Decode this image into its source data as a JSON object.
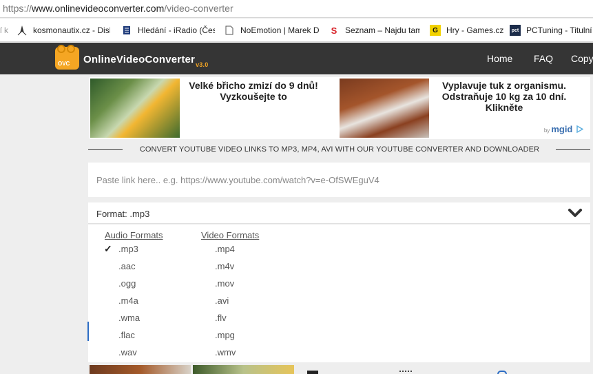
{
  "address_bar": {
    "protocol": "https://",
    "host": "www.onlinevideoconverter.com",
    "path": "/video-converter"
  },
  "bookmarks": [
    {
      "label": "ſ k",
      "icon": "partial-icon"
    },
    {
      "label": "kosmonautix.cz - Disk",
      "icon": "rocket-icon"
    },
    {
      "label": "Hledání - iRadio (Česk",
      "icon": "document-icon"
    },
    {
      "label": "NoEmotion | Marek D",
      "icon": "page-icon"
    },
    {
      "label": "Seznam – Najdu tam",
      "icon": "seznam-icon"
    },
    {
      "label": "Hry - Games.cz",
      "icon": "games-icon"
    },
    {
      "label": "PCTuning - Titulní",
      "icon": "pctuning-icon"
    }
  ],
  "site": {
    "logo_badge": "OVC",
    "logo_name": "OnlineVideoConverter",
    "logo_version": "v3.0",
    "nav": [
      "Home",
      "FAQ",
      "Copy"
    ]
  },
  "ads": {
    "ad1": {
      "line1": "Velké břicho zmizí do 9 dnů!",
      "line2": "Vyzkoušejte to"
    },
    "ad2": {
      "line1": "Vyplavuje tuk z organismu.",
      "line2": "Odstraňuje 10 kg za 10 dní.",
      "line3": "Klikněte"
    },
    "sponsor_by": "by",
    "sponsor_name": "mgid"
  },
  "tagline": "CONVERT YOUTUBE VIDEO LINKS TO MP3, MP4, AVI WITH OUR YOUTUBE CONVERTER AND DOWNLOADER",
  "link_input": {
    "placeholder": "Paste link here.. e.g. https://www.youtube.com/watch?v=e-OfSWEguV4",
    "value": ""
  },
  "format": {
    "label": "Format: .mp3",
    "selected": ".mp3",
    "audio_header": "Audio Formats",
    "video_header": "Video Formats",
    "audio": [
      ".mp3",
      ".aac",
      ".ogg",
      ".m4a",
      ".wma",
      ".flac",
      ".wav"
    ],
    "video": [
      ".mp4",
      ".m4v",
      ".mov",
      ".avi",
      ".flv",
      ".mpg",
      ".wmv"
    ],
    "check_glyph": "✓"
  },
  "colors": {
    "header_bg": "#353535",
    "accent": "#f5a623",
    "page_bg": "#eeeeee",
    "mgid": "#3a6fb0"
  }
}
